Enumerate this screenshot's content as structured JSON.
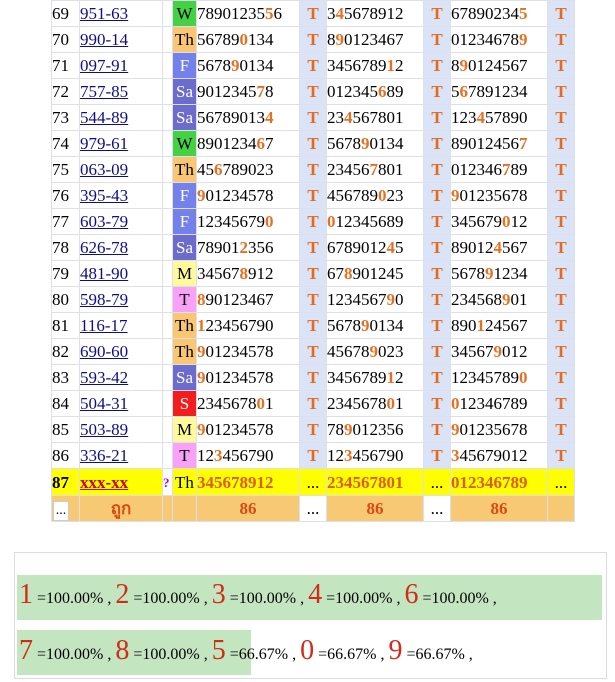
{
  "rows": [
    {
      "n": "69",
      "code": "951-63",
      "day": "W",
      "a": [
        "78901235",
        "5",
        "6"
      ],
      "b": [
        "3",
        "4",
        "5678912"
      ],
      "c": [
        "67890234",
        "5",
        ""
      ]
    },
    {
      "n": "70",
      "code": "990-14",
      "day": "Th",
      "a": [
        "56789",
        "0",
        "134"
      ],
      "b": [
        "8",
        "9",
        "0123467"
      ],
      "c": [
        "01234678",
        "9",
        ""
      ]
    },
    {
      "n": "71",
      "code": "097-91",
      "day": "F",
      "a": [
        "5678",
        "9",
        "0134"
      ],
      "b": [
        "3456789",
        "1",
        "2"
      ],
      "c": [
        "8",
        "9",
        "0124567"
      ]
    },
    {
      "n": "72",
      "code": "757-85",
      "day": "Sa",
      "a": [
        "9012345",
        "7",
        "8"
      ],
      "b": [
        "012345",
        "6",
        "89"
      ],
      "c": [
        "5",
        "6",
        "7891234"
      ]
    },
    {
      "n": "73",
      "code": "544-89",
      "day": "Sa",
      "a": [
        "56789013",
        "4",
        ""
      ],
      "b": [
        "23",
        "4",
        "567801"
      ],
      "c": [
        "123",
        "4",
        "57890"
      ]
    },
    {
      "n": "74",
      "code": "979-61",
      "day": "W",
      "a": [
        "8901234",
        "6",
        "7"
      ],
      "b": [
        "5678",
        "9",
        "0134"
      ],
      "c": [
        "89012456",
        "7",
        ""
      ]
    },
    {
      "n": "75",
      "code": "063-09",
      "day": "Th",
      "a": [
        "45",
        "6",
        "789023"
      ],
      "b": [
        "23456",
        "7",
        "801"
      ],
      "c": [
        "012346",
        "7",
        "89"
      ]
    },
    {
      "n": "76",
      "code": "395-43",
      "day": "F",
      "a": [
        "",
        "9",
        "01234578"
      ],
      "b": [
        "456789",
        "0",
        "23"
      ],
      "c": [
        "",
        "9",
        "01235678"
      ]
    },
    {
      "n": "77",
      "code": "603-79",
      "day": "F",
      "a": [
        "12345679",
        "0",
        ""
      ],
      "b": [
        "",
        "0",
        "12345689"
      ],
      "c": [
        "345679",
        "0",
        "12"
      ]
    },
    {
      "n": "78",
      "code": "626-78",
      "day": "Sa",
      "a": [
        "78901",
        "2",
        "356"
      ],
      "b": [
        "6789012",
        "4",
        "5"
      ],
      "c": [
        "89012",
        "4",
        "567"
      ]
    },
    {
      "n": "79",
      "code": "481-90",
      "day": "M",
      "a": [
        "34567",
        "8",
        "912"
      ],
      "b": [
        "67",
        "8",
        "901245"
      ],
      "c": [
        "5678",
        "9",
        "1234"
      ]
    },
    {
      "n": "80",
      "code": "598-79",
      "day": "T",
      "a": [
        "",
        "8",
        "90123467"
      ],
      "b": [
        "1234567",
        "9",
        "0"
      ],
      "c": [
        "234568",
        "9",
        "01"
      ]
    },
    {
      "n": "81",
      "code": "116-17",
      "day": "Th",
      "a": [
        "",
        "1",
        "23456790"
      ],
      "b": [
        "5678",
        "9",
        "0134"
      ],
      "c": [
        "890",
        "1",
        "24567"
      ]
    },
    {
      "n": "82",
      "code": "690-60",
      "day": "Th",
      "a": [
        "",
        "9",
        "01234578"
      ],
      "b": [
        "45678",
        "9",
        "023"
      ],
      "c": [
        "34567",
        "9",
        "012"
      ]
    },
    {
      "n": "83",
      "code": "593-42",
      "day": "Sa",
      "a": [
        "",
        "9",
        "01234578"
      ],
      "b": [
        "3456789",
        "1",
        "2"
      ],
      "c": [
        "12345789",
        "0",
        ""
      ]
    },
    {
      "n": "84",
      "code": "504-31",
      "day": "S",
      "a": [
        "2345678",
        "0",
        "1"
      ],
      "b": [
        "2345678",
        "0",
        "1"
      ],
      "c": [
        "",
        "0",
        "12346789"
      ]
    },
    {
      "n": "85",
      "code": "503-89",
      "day": "M",
      "a": [
        "",
        "9",
        "01234578"
      ],
      "b": [
        "78",
        "9",
        "012356"
      ],
      "c": [
        "",
        "9",
        "01235678"
      ]
    },
    {
      "n": "86",
      "code": "336-21",
      "day": "T",
      "a": [
        "12",
        "3",
        "456790"
      ],
      "b": [
        "12",
        "3",
        "456790"
      ],
      "c": [
        "",
        "3",
        "45679012"
      ]
    }
  ],
  "t_label": "T",
  "pred": {
    "n": "87",
    "code": "xxx-xx",
    "q": "?",
    "day": "Th",
    "a": "345678912",
    "b": "234567801",
    "c": "012346789",
    "dots": "..."
  },
  "foot": {
    "dots": "...",
    "label": "ถูก",
    "a": "86",
    "b": "86",
    "c": "86"
  },
  "summary": {
    "line1": [
      {
        "d": "1",
        "p": "=100.00%"
      },
      {
        "d": "2",
        "p": "=100.00%"
      },
      {
        "d": "3",
        "p": "=100.00%"
      },
      {
        "d": "4",
        "p": "=100.00%"
      },
      {
        "d": "6",
        "p": "=100.00%"
      }
    ],
    "line2": [
      {
        "d": "7",
        "p": "=100.00%"
      },
      {
        "d": "8",
        "p": "=100.00%"
      },
      {
        "d": "5",
        "p": "=66.67%"
      },
      {
        "d": "0",
        "p": "=66.67%"
      },
      {
        "d": "9",
        "p": "=66.67%"
      }
    ]
  }
}
